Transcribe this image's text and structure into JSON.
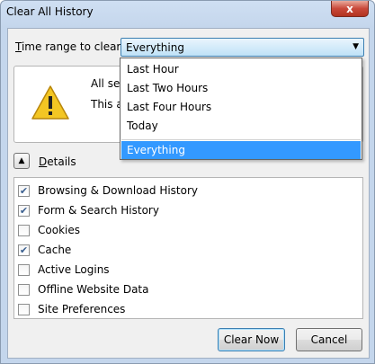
{
  "window": {
    "title": "Clear All History",
    "close_symbol": "x"
  },
  "range": {
    "label_key": "T",
    "label_rest": "ime range to clear:",
    "selected": "Everything",
    "options": [
      "Last Hour",
      "Last Two Hours",
      "Last Four Hours",
      "Today",
      "Everything"
    ]
  },
  "info": {
    "line1": "All sele",
    "line2": "This ac"
  },
  "details": {
    "label_key": "D",
    "label_rest": "etails"
  },
  "items": [
    {
      "label": "Browsing & Download History",
      "checked": true
    },
    {
      "label": "Form & Search History",
      "checked": true
    },
    {
      "label": "Cookies",
      "checked": false
    },
    {
      "label": "Cache",
      "checked": true
    },
    {
      "label": "Active Logins",
      "checked": false
    },
    {
      "label": "Offline Website Data",
      "checked": false
    },
    {
      "label": "Site Preferences",
      "checked": false
    }
  ],
  "buttons": {
    "clear_now": "Clear Now",
    "cancel": "Cancel"
  },
  "colors": {
    "selection": "#3399ff",
    "warning": "#f3c623"
  }
}
